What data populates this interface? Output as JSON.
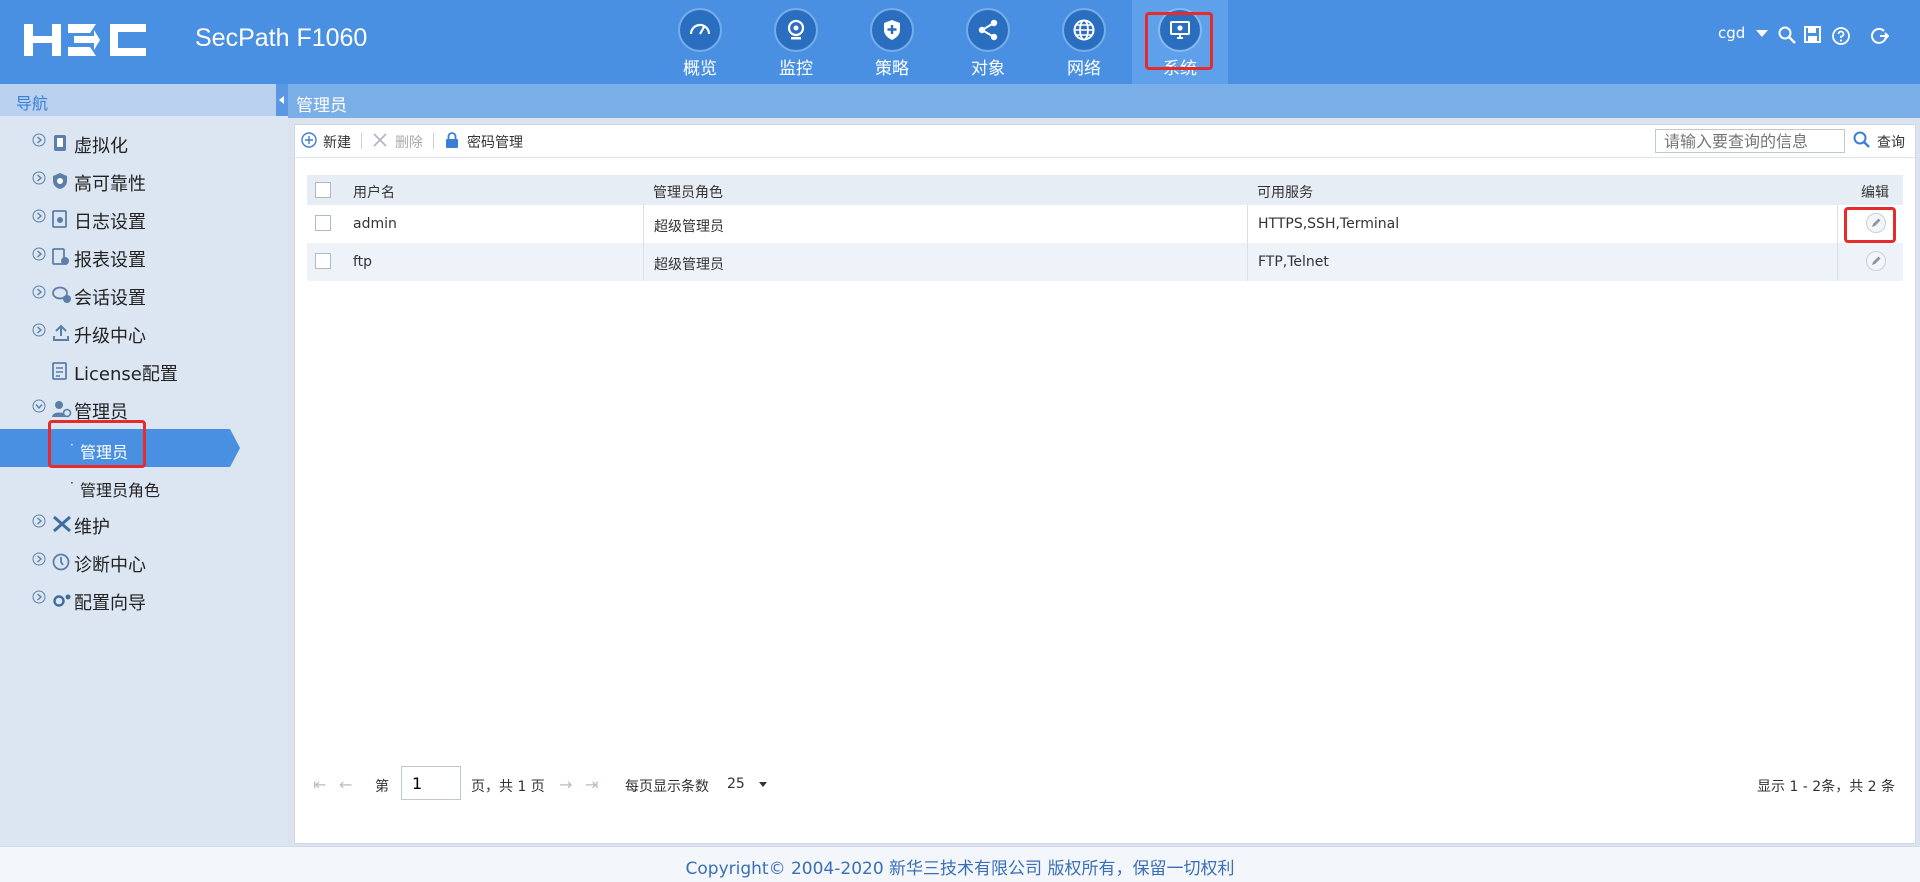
{
  "header": {
    "brand_logo": "H3C",
    "product": "SecPath F1060",
    "nav": [
      {
        "label": "概览",
        "icon": "dashboard-gauge-icon"
      },
      {
        "label": "监控",
        "icon": "monitor-camera-icon"
      },
      {
        "label": "策略",
        "icon": "policy-shield-icon"
      },
      {
        "label": "对象",
        "icon": "object-share-icon"
      },
      {
        "label": "网络",
        "icon": "network-globe-icon"
      },
      {
        "label": "系统",
        "icon": "system-screen-icon",
        "active": true
      }
    ],
    "user": "cgd",
    "accent_color": "#4a90e2",
    "highlight_color": "#e52b2b"
  },
  "sidebar": {
    "title": "导航",
    "items": [
      {
        "label": "虚拟化",
        "icon": "virtualization-icon"
      },
      {
        "label": "高可靠性",
        "icon": "shield-icon"
      },
      {
        "label": "日志设置",
        "icon": "log-settings-icon"
      },
      {
        "label": "报表设置",
        "icon": "report-settings-icon"
      },
      {
        "label": "会话设置",
        "icon": "session-settings-icon"
      },
      {
        "label": "升级中心",
        "icon": "upgrade-icon"
      },
      {
        "label": "License配置",
        "icon": "license-icon"
      },
      {
        "label": "管理员",
        "icon": "admin-user-icon",
        "expanded": true,
        "children": [
          {
            "label": "管理员",
            "active": true
          },
          {
            "label": "管理员角色"
          }
        ]
      },
      {
        "label": "维护",
        "icon": "maintenance-tools-icon"
      },
      {
        "label": "诊断中心",
        "icon": "diagnostics-icon"
      },
      {
        "label": "配置向导",
        "icon": "config-wizard-icon"
      }
    ]
  },
  "main": {
    "title": "管理员",
    "toolbar": {
      "new_label": "新建",
      "delete_label": "删除",
      "password_label": "密码管理",
      "search_placeholder": "请输入要查询的信息",
      "search_label": "查询"
    },
    "table": {
      "columns": [
        "用户名",
        "管理员角色",
        "可用服务",
        "编辑"
      ],
      "rows": [
        {
          "username": "admin",
          "role": "超级管理员",
          "services": "HTTPS,SSH,Terminal"
        },
        {
          "username": "ftp",
          "role": "超级管理员",
          "services": "FTP,Telnet"
        }
      ]
    },
    "pager": {
      "page_prefix": "第",
      "page_value": "1",
      "page_suffix": "页，共 1 页",
      "page_size_label": "每页显示条数",
      "page_size": "25",
      "summary": "显示 1 - 2条，共 2 条"
    }
  },
  "footer": {
    "copyright": "Copyright© 2004-2020 新华三技术有限公司 版权所有，保留一切权利"
  }
}
